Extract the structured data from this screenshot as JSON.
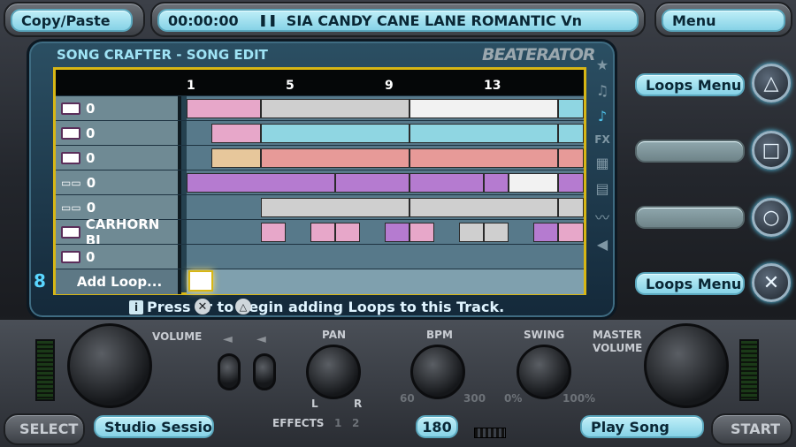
{
  "top": {
    "copy_paste": "Copy/Paste",
    "time": "00:00:00",
    "song_title": "SIA CANDY CANE LANE ROMANTIC Vn",
    "menu": "Menu"
  },
  "editor": {
    "header": "SONG CRAFTER - SONG EDIT",
    "logo": "BEATERATOR",
    "ruler_ticks": [
      "1",
      "5",
      "9",
      "13"
    ],
    "tracks": [
      {
        "label": "0",
        "icon": "keyboard-icon"
      },
      {
        "label": "0",
        "icon": "keyboard-icon"
      },
      {
        "label": "0",
        "icon": "keyboard-icon"
      },
      {
        "label": "0",
        "icon": "drum-pad-icon"
      },
      {
        "label": "0",
        "icon": "drum-pad-icon"
      },
      {
        "label": "CARHORN BI",
        "icon": "keyboard-icon"
      },
      {
        "label": "0",
        "icon": "keyboard-icon"
      }
    ],
    "add_loop": "Add Loop...",
    "track_number": "8",
    "hint": "Press  or  to begin adding Loops to this Track."
  },
  "side": {
    "loops_menu_top": "Loops Menu",
    "loops_menu_bottom": "Loops Menu",
    "mid1": "",
    "mid2": ""
  },
  "controls": {
    "volume_label": "VOLUME",
    "pan_label": "PAN",
    "pan_l": "L",
    "pan_r": "R",
    "effects_label": "EFFECTS",
    "effects_1": "1",
    "effects_2": "2",
    "bpm_label": "BPM",
    "bpm_min": "60",
    "bpm_max": "300",
    "swing_label": "SWING",
    "swing_min": "0%",
    "swing_max": "100%",
    "master_label_1": "MASTER",
    "master_label_2": "VOLUME"
  },
  "bottom": {
    "select": "SELECT",
    "studio_session": "Studio Session",
    "bpm_value": "180",
    "play_song": "Play Song",
    "start": "START"
  },
  "colors": {
    "pink": "#e7a7c9",
    "gray": "#cfcfcf",
    "white": "#f2f2f2",
    "cyan": "#8fd6e2",
    "orange": "#e7c79b",
    "salmon": "#e79a98",
    "purple": "#b57bd0",
    "highlight": "#d7b615"
  }
}
